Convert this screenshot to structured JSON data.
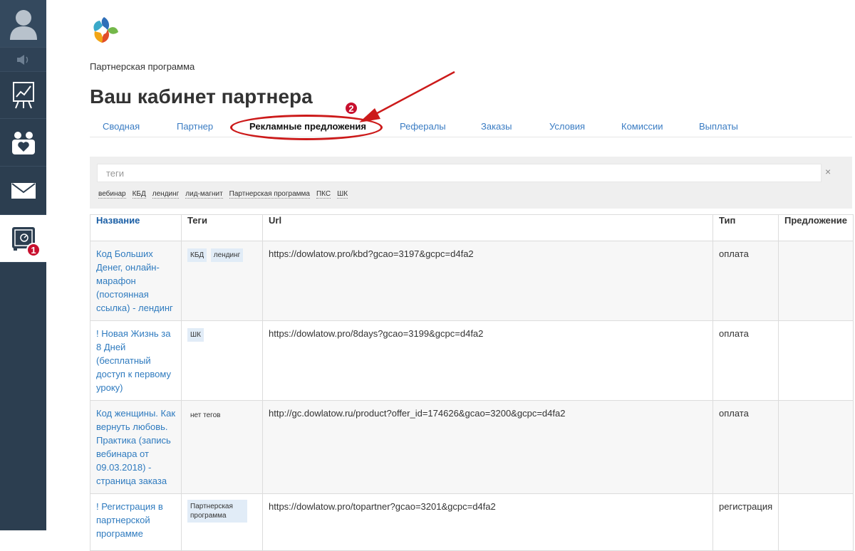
{
  "breadcrumb": "Партнерская программа",
  "page_title": "Ваш кабинет партнера",
  "tabs": [
    "Сводная",
    "Партнер",
    "Рекламные предложения",
    "Рефералы",
    "Заказы",
    "Условия",
    "Комиссии",
    "Выплаты"
  ],
  "active_tab": "Рекламные предложения",
  "annotations": {
    "badge1": "1",
    "badge2": "2"
  },
  "filter": {
    "placeholder": "теги",
    "clear": "×",
    "tags": [
      "вебинар",
      "КБД",
      "лендинг",
      "лид-магнит",
      "Партнерская программа",
      "ПКС",
      "ШК"
    ]
  },
  "table": {
    "headers": {
      "name": "Название",
      "tags": "Теги",
      "url": "Url",
      "type": "Тип",
      "offer": "Предложение"
    },
    "rows": [
      {
        "name": "Код Больших Денег, онлайн-марафон (постоянная ссылка) - лендинг",
        "tags": [
          "КБД",
          "лендинг"
        ],
        "url": "https://dowlatow.pro/kbd?gcao=3197&gcpc=d4fa2",
        "type": "оплата",
        "offer": ""
      },
      {
        "name": "! Новая Жизнь за 8 Дней (бесплатный доступ к первому уроку)",
        "tags": [
          "ШК"
        ],
        "url": "https://dowlatow.pro/8days?gcao=3199&gcpc=d4fa2",
        "type": "оплата",
        "offer": ""
      },
      {
        "name": "Код женщины. Как вернуть любовь. Практика (запись вебинара от 09.03.2018) - страница заказа",
        "tags": [],
        "no_tags": "нет тегов",
        "url": "http://gc.dowlatow.ru/product?offer_id=174626&gcao=3200&gcpc=d4fa2",
        "type": "оплата",
        "offer": ""
      },
      {
        "name": "! Регистрация в партнерской программе",
        "tags": [
          "Партнерская программа"
        ],
        "url": "https://dowlatow.pro/topartner?gcao=3201&gcpc=d4fa2",
        "type": "регистрация",
        "offer": ""
      }
    ]
  },
  "colors": {
    "sidebar": "#2c3e50",
    "link": "#2f7bbf",
    "annotation_red": "#cc1a1a",
    "chip": "#e1ecf7"
  }
}
